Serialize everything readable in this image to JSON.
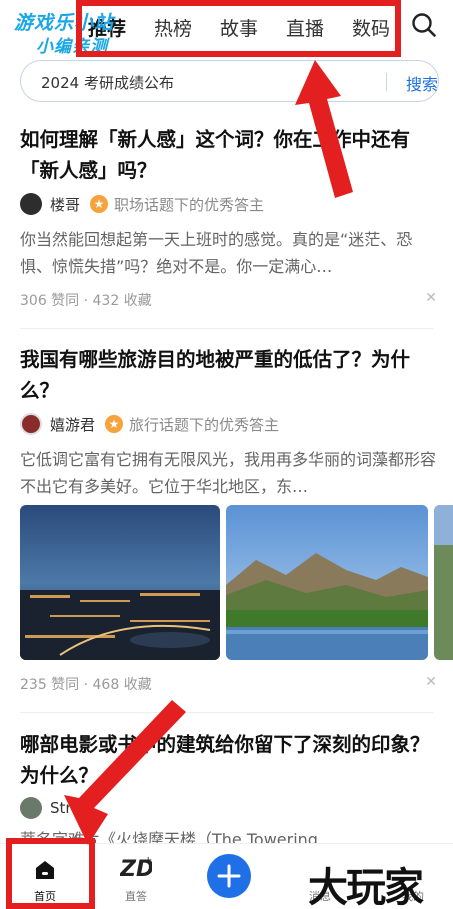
{
  "watermark": {
    "line1": "游戏乐小站",
    "line2": "小编亲测"
  },
  "tabs": [
    {
      "label": "推荐",
      "active": true
    },
    {
      "label": "热榜",
      "active": false
    },
    {
      "label": "故事",
      "active": false
    },
    {
      "label": "直播",
      "active": false
    },
    {
      "label": "数码",
      "active": false
    }
  ],
  "search": {
    "query": "2024 考研成绩公布",
    "button": "搜索"
  },
  "cards": [
    {
      "title": "如何理解「新人感」这个词？你在工作中还有「新人感」吗？",
      "author": "楼哥",
      "badge_desc": "职场话题下的优秀答主",
      "excerpt": "你当然能回想起第一天上班时的感觉。真的是“迷茫、恐惧、惊慌失措”吗？绝对不是。你一定满心…",
      "stats": "306 赞同 · 432 收藏"
    },
    {
      "title": "我国有哪些旅游目的地被严重的低估了？为什么？",
      "author": "嬉游君",
      "badge_desc": "旅行话题下的优秀答主",
      "excerpt": "它低调它富有它拥有无限风光，我用再多华丽的词藻都形容不出它有多美好。它位于华北地区，东…",
      "stats": "235 赞同 · 468 收藏"
    },
    {
      "title": "哪部电影或书中的建筑给你留下了深刻的印象？为什么？",
      "author": "Strive",
      "excerpt": "蒂名字难片《火烧摩天楼（The Towering"
    }
  ],
  "bottom_nav": [
    {
      "label": "首页"
    },
    {
      "label": "直答"
    },
    {
      "label": ""
    },
    {
      "label": "消息"
    },
    {
      "label": "我的"
    }
  ],
  "corner_text": "大玩家",
  "colors": {
    "accent": "#1f6fe6",
    "highlight": "#e41f1f",
    "watermark": "#19a7e6"
  }
}
